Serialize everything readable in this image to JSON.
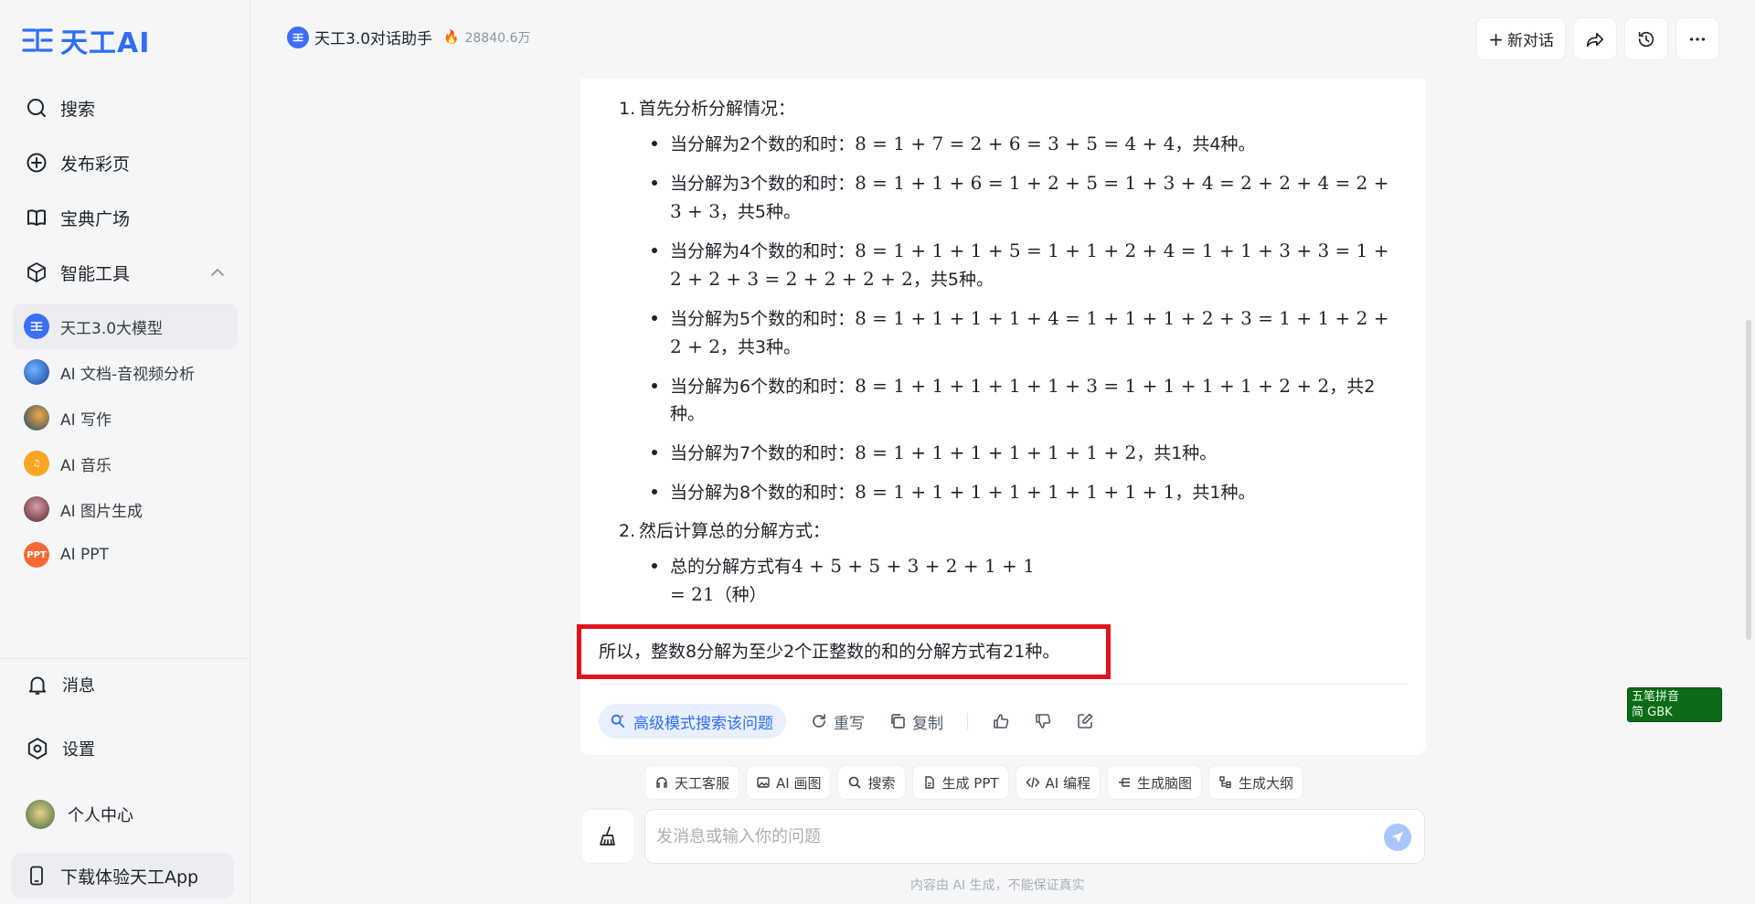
{
  "brand": {
    "name": "天工AI",
    "color": "#2f6df6"
  },
  "nav": {
    "search": "搜索",
    "publish": "发布彩页",
    "plaza": "宝典广场",
    "tools": "智能工具"
  },
  "subnav": [
    {
      "label": "天工3.0大模型",
      "color": "#3b6ff5",
      "text": ""
    },
    {
      "label": "AI 文档-音视频分析",
      "color": "#2457c9",
      "text": ""
    },
    {
      "label": "AI 写作",
      "color": "#1d5a76",
      "text": ""
    },
    {
      "label": "AI 音乐",
      "color": "#f6a623",
      "text": "♫"
    },
    {
      "label": "AI 图片生成",
      "color": "#7a2f3f",
      "text": ""
    },
    {
      "label": "AI PPT",
      "color": "#f56a34",
      "text": "PPT"
    }
  ],
  "bottom": {
    "messages": "消息",
    "settings": "设置",
    "profile": "个人中心",
    "download": "下载体验天工App"
  },
  "header": {
    "assistant": "天工3.0对话助手",
    "count": "28840.6万",
    "new_chat": "新对话"
  },
  "answer": {
    "step1": "首先分析分解情况：",
    "step1_bullets": [
      {
        "text": "当分解为2个数的和时：",
        "math": "8 = 1 + 7 = 2 + 6 = 3 + 5 = 4 + 4",
        "tail": "，共4种。"
      },
      {
        "text": "当分解为3个数的和时：",
        "math": "8 = 1 + 1 + 6 = 1 + 2 + 5 = 1 + 3 + 4 = 2 + 2 + 4 = 2 + 3 + 3",
        "tail": "，共5种。"
      },
      {
        "text": "当分解为4个数的和时：",
        "math": "8 = 1 + 1 + 1 + 5 = 1 + 1 + 2 + 4 = 1 + 1 + 3 + 3 = 1 + 2 + 2 + 3 = 2 + 2 + 2 + 2",
        "tail": "，共5种。"
      },
      {
        "text": "当分解为5个数的和时：",
        "math": "8 = 1 + 1 + 1 + 1 + 4 = 1 + 1 + 1 + 2 + 3 = 1 + 1 + 2 + 2 + 2",
        "tail": "，共3种。"
      },
      {
        "text": "当分解为6个数的和时：",
        "math": "8 = 1 + 1 + 1 + 1 + 1 + 3 = 1 + 1 + 1 + 1 + 2 + 2",
        "tail": "，共2种。"
      },
      {
        "text": "当分解为7个数的和时：",
        "math": "8 = 1 + 1 + 1 + 1 + 1 + 1 + 2",
        "tail": "，共1种。"
      },
      {
        "text": "当分解为8个数的和时：",
        "math": "8 = 1 + 1 + 1 + 1 + 1 + 1 + 1 + 1",
        "tail": "，共1种。"
      }
    ],
    "step2": "然后计算总的分解方式：",
    "step2_text": "总的分解方式有",
    "step2_math1": "4 + 5 + 5 + 3 + 2 + 1 + 1",
    "step2_math2": "= 21",
    "step2_tail": "（种）",
    "conclusion": "所以，整数8分解为至少2个正整数的和的分解方式有21种。"
  },
  "actions": {
    "advanced_search": "高级模式搜索该问题",
    "rewrite": "重写",
    "copy": "复制"
  },
  "tools": [
    "天工客服",
    "AI 画图",
    "搜索",
    "生成 PPT",
    "AI 编程",
    "生成脑图",
    "生成大纲"
  ],
  "input": {
    "placeholder": "发消息或输入你的问题"
  },
  "disclaimer": "内容由 AI 生成，不能保证真实",
  "ime": {
    "line1": "五笔拼音",
    "line2": "简 GBK"
  }
}
